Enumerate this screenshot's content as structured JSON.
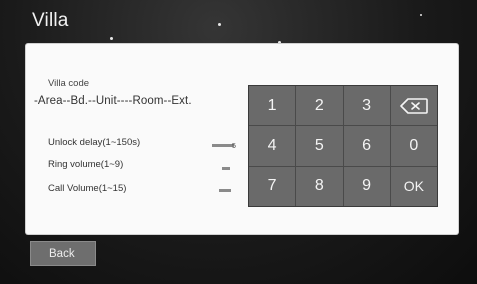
{
  "header": {
    "title": "Villa"
  },
  "form": {
    "code_label": "Villa code",
    "code_format": "-Area--Bd.--Unit----Room--Ext.",
    "settings": [
      {
        "label": "Unlock delay(1~150s)",
        "value": "5"
      },
      {
        "label": "Ring volume(1~9)",
        "value": ""
      },
      {
        "label": "Call Volume(1~15)",
        "value": ""
      }
    ]
  },
  "keypad": {
    "keys": [
      "1",
      "2",
      "3",
      "backspace-icon",
      "4",
      "5",
      "6",
      "0",
      "7",
      "8",
      "9",
      "OK"
    ]
  },
  "footer": {
    "back_label": "Back"
  },
  "colors": {
    "panel": "#fafafa",
    "key_face": "#6a6a6a",
    "background": "#1a1a1a"
  }
}
